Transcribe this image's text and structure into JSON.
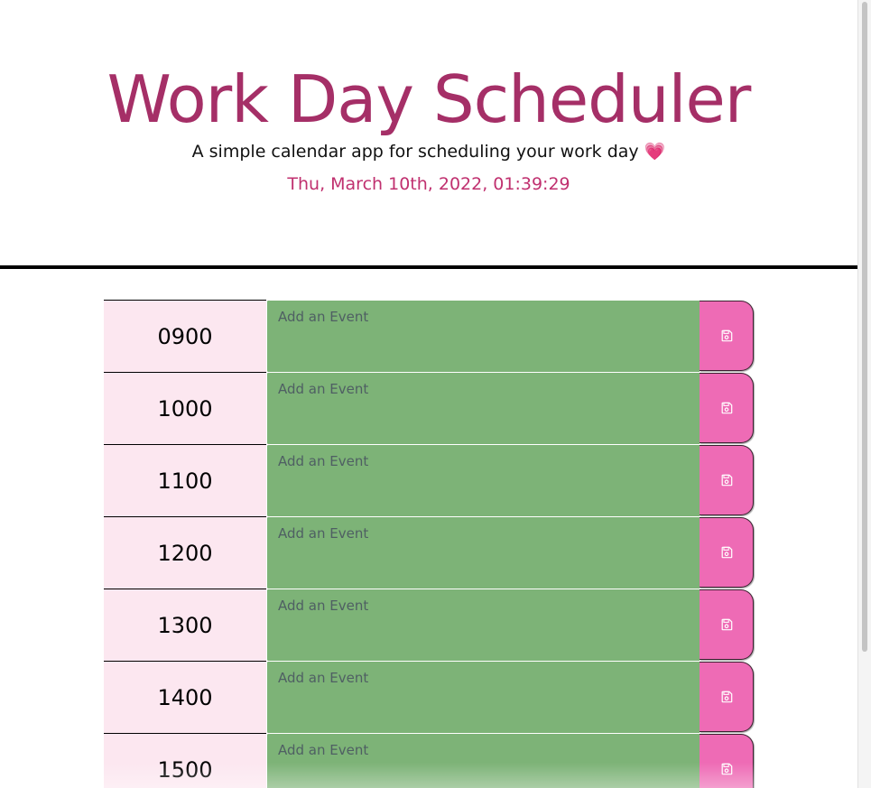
{
  "header": {
    "title": "Work Day Scheduler",
    "lead": "A simple calendar app for scheduling your work day",
    "lead_emoji": "💗",
    "current_date": "Thu, March 10th, 2022, 01:39:29"
  },
  "scheduler": {
    "rows": [
      {
        "hour": "0900",
        "placeholder": "Add an Event",
        "value": ""
      },
      {
        "hour": "1000",
        "placeholder": "Add an Event",
        "value": ""
      },
      {
        "hour": "1100",
        "placeholder": "Add an Event",
        "value": ""
      },
      {
        "hour": "1200",
        "placeholder": "Add an Event",
        "value": ""
      },
      {
        "hour": "1300",
        "placeholder": "Add an Event",
        "value": ""
      },
      {
        "hour": "1400",
        "placeholder": "Add an Event",
        "value": ""
      },
      {
        "hour": "1500",
        "placeholder": "Add an Event",
        "value": ""
      }
    ],
    "save_icon": "floppy-disk-icon"
  },
  "colors": {
    "title": "#a52f67",
    "date": "#c0306f",
    "hour_bg": "#fce7f0",
    "event_present_bg": "#7db377",
    "save_button_bg": "#ee6bb5"
  }
}
